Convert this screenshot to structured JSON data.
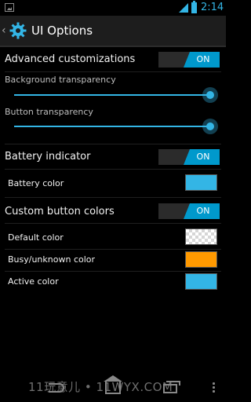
{
  "status_bar": {
    "time": "2:14"
  },
  "action_bar": {
    "back_glyph": "‹",
    "title": "UI Options",
    "icon": "gear-icon"
  },
  "settings": {
    "advanced": {
      "label": "Advanced customizations",
      "toggle": "ON"
    },
    "background_transparency": {
      "label": "Background transparency",
      "value_fraction": 1.0
    },
    "button_transparency": {
      "label": "Button transparency",
      "value_fraction": 1.0
    },
    "battery_indicator": {
      "label": "Battery indicator",
      "toggle": "ON"
    },
    "battery_color": {
      "label": "Battery color",
      "color": "#33b5e5"
    },
    "custom_button_colors": {
      "label": "Custom button colors",
      "toggle": "ON"
    },
    "default_color": {
      "label": "Default color",
      "color": "transparent"
    },
    "busy_color": {
      "label": "Busy/unknown color",
      "color": "#ff9900"
    },
    "active_color": {
      "label": "Active color",
      "color": "#33b5e5"
    }
  },
  "nav_bar": {
    "watermark": "11玩意儿 • 11WYX.COM"
  },
  "colors": {
    "accent": "#33b5e5",
    "toggle_on": "#0099cc",
    "background": "#000000"
  }
}
